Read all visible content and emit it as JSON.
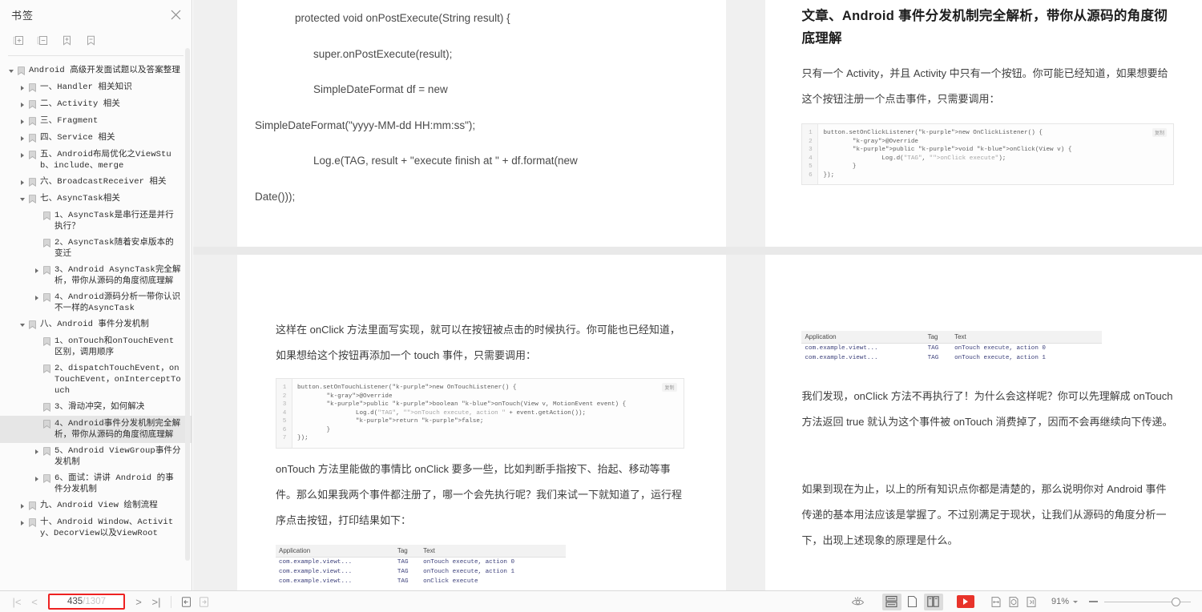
{
  "sidebar": {
    "panel_title": "书签",
    "close_label": "×",
    "toolbar": [
      {
        "name": "expand-all-icon",
        "title": "展开全部"
      },
      {
        "name": "collapse-all-icon",
        "title": "折叠全部"
      },
      {
        "name": "add-bookmark-icon",
        "title": "添加书签"
      },
      {
        "name": "remove-bookmark-icon",
        "title": "删除书签"
      }
    ],
    "tree": [
      {
        "level": 0,
        "state": "expanded",
        "label": "Android 高级开发面试题以及答案整理",
        "selected": false
      },
      {
        "level": 1,
        "state": "collapsed",
        "label": "一、Handler 相关知识",
        "selected": false
      },
      {
        "level": 1,
        "state": "collapsed",
        "label": "二、Activity 相关",
        "selected": false
      },
      {
        "level": 1,
        "state": "collapsed",
        "label": "三、Fragment",
        "selected": false
      },
      {
        "level": 1,
        "state": "collapsed",
        "label": "四、Service 相关",
        "selected": false
      },
      {
        "level": 1,
        "state": "collapsed",
        "label": "五、Android布局优化之ViewStub、include、merge",
        "selected": false
      },
      {
        "level": 1,
        "state": "collapsed",
        "label": "六、BroadcastReceiver 相关",
        "selected": false
      },
      {
        "level": 1,
        "state": "expanded",
        "label": "七、AsyncTask相关",
        "selected": false
      },
      {
        "level": 2,
        "state": "leaf",
        "label": "1、AsyncTask是串行还是并行执行？",
        "selected": false
      },
      {
        "level": 2,
        "state": "leaf",
        "label": "2、AsyncTask随着安卓版本的变迁",
        "selected": false
      },
      {
        "level": 2,
        "state": "collapsed",
        "label": "3、Android AsyncTask完全解析，带你从源码的角度彻底理解",
        "selected": false
      },
      {
        "level": 2,
        "state": "collapsed",
        "label": "4、Android源码分析一带你认识不一样的AsyncTask",
        "selected": false
      },
      {
        "level": 1,
        "state": "expanded",
        "label": "八、Android 事件分发机制",
        "selected": false
      },
      {
        "level": 2,
        "state": "leaf",
        "label": "1、onTouch和onTouchEvent区别，调用顺序",
        "selected": false
      },
      {
        "level": 2,
        "state": "leaf",
        "label": "2、dispatchTouchEvent，onTouchEvent，onInterceptTouch",
        "selected": false
      },
      {
        "level": 2,
        "state": "leaf",
        "label": "3、滑动冲突，如何解决",
        "selected": false
      },
      {
        "level": 2,
        "state": "leaf",
        "label": "4、Android事件分发机制完全解析，带你从源码的角度彻底理解",
        "selected": true
      },
      {
        "level": 2,
        "state": "collapsed",
        "label": "5、Android ViewGroup事件分发机制",
        "selected": false
      },
      {
        "level": 2,
        "state": "collapsed",
        "label": "6、面试：讲讲 Android 的事件分发机制",
        "selected": false
      },
      {
        "level": 1,
        "state": "collapsed",
        "label": "九、Android View 绘制流程",
        "selected": false
      },
      {
        "level": 1,
        "state": "collapsed",
        "label": "十、Android Window、Activity、DecorView以及ViewRoot",
        "selected": false
      }
    ]
  },
  "document": {
    "page_top_left": {
      "code_lines": [
        {
          "text": "protected void onPostExecute(String result) {",
          "indent": 50
        },
        {
          "text": "super.onPostExecute(result);",
          "indent": 73
        },
        {
          "text": "SimpleDateFormat df = new",
          "indent": 73
        },
        {
          "text": "SimpleDateFormat(\"yyyy-MM-dd HH:mm:ss\");",
          "indent": 0
        },
        {
          "text": "Log.e(TAG, result + \"execute finish at \" + df.format(new",
          "indent": 73
        },
        {
          "text": "Date()));",
          "indent": 0
        }
      ]
    },
    "page_top_right": {
      "heading": "文章、Android 事件分发机制完全解析，带你从源码的角度彻底理解",
      "paragraph": "只有一个 Activity，并且 Activity 中只有一个按钮。你可能已经知道，如果想要给这个按钮注册一个点击事件，只需要调用：",
      "code_block": {
        "copy_label": "复制",
        "lines": [
          {
            "no": "1",
            "text": "button.setOnClickListener(new OnClickListener() {"
          },
          {
            "no": "2",
            "text": "        @Override"
          },
          {
            "no": "3",
            "text": "        public void onClick(View v) {"
          },
          {
            "no": "4",
            "text": "                Log.d(\"TAG\", \"onClick execute\");"
          },
          {
            "no": "5",
            "text": "        }"
          },
          {
            "no": "6",
            "text": "});"
          }
        ]
      }
    },
    "page_bottom_left": {
      "paragraph1": "这样在 onClick 方法里面写实现，就可以在按钮被点击的时候执行。你可能也已经知道，如果想给这个按钮再添加一个 touch 事件，只需要调用：",
      "code_block": {
        "copy_label": "复制",
        "lines": [
          {
            "no": "1",
            "text": "button.setOnTouchListener(new OnTouchListener() {"
          },
          {
            "no": "2",
            "text": "        @Override"
          },
          {
            "no": "3",
            "text": "        public boolean onTouch(View v, MotionEvent event) {"
          },
          {
            "no": "4",
            "text": "                Log.d(\"TAG\", \"onTouch execute, action \" + event.getAction());"
          },
          {
            "no": "5",
            "text": "                return false;"
          },
          {
            "no": "6",
            "text": "        }"
          },
          {
            "no": "7",
            "text": "});"
          }
        ]
      },
      "paragraph2": "onTouch 方法里能做的事情比 onClick 要多一些，比如判断手指按下、抬起、移动等事件。那么如果我两个事件都注册了，哪一个会先执行呢？我们来试一下就知道了，运行程序点击按钮，打印结果如下：",
      "log_table": {
        "headers": [
          "Application",
          "Tag",
          "Text"
        ],
        "rows": [
          [
            "com.example.viewt...",
            "TAG",
            "onTouch execute, action 0"
          ],
          [
            "com.example.viewt...",
            "TAG",
            "onTouch execute, action 1"
          ],
          [
            "com.example.viewt...",
            "TAG",
            "onClick execute"
          ]
        ]
      }
    },
    "page_bottom_right": {
      "log_table": {
        "headers": [
          "Application",
          "Tag",
          "Text"
        ],
        "rows": [
          [
            "com.example.viewt...",
            "TAG",
            "onTouch execute, action 0"
          ],
          [
            "com.example.viewt...",
            "TAG",
            "onTouch execute, action 1"
          ]
        ]
      },
      "paragraph1": "我们发现，onClick 方法不再执行了！为什么会这样呢？你可以先理解成 onTouch 方法返回 true 就认为这个事件被 onTouch 消费掉了，因而不会再继续向下传递。",
      "paragraph2": "如果到现在为止，以上的所有知识点你都是清楚的，那么说明你对 Android 事件传递的基本用法应该是掌握了。不过别满足于现状，让我们从源码的角度分析一下，出现上述现象的原理是什么。"
    }
  },
  "bottombar": {
    "first_page_label": "|<",
    "prev_page_label": "<",
    "current_page": "435",
    "total_pages": "/1307",
    "next_page_label": ">",
    "last_page_label": ">|",
    "nav_icons": [
      {
        "name": "previous-view-icon"
      },
      {
        "name": "next-view-icon"
      }
    ],
    "view_modes": [
      {
        "name": "continuous-scroll-icon",
        "active": true
      },
      {
        "name": "single-page-icon",
        "active": false
      },
      {
        "name": "two-page-spread-icon",
        "active": false
      }
    ],
    "presentation_label": "演示",
    "fit_icons": [
      {
        "name": "fit-width-icon"
      },
      {
        "name": "fit-page-icon"
      },
      {
        "name": "actual-size-icon"
      }
    ],
    "eye_icon": "reading-mode-icon",
    "zoom_level": "91%",
    "accent_red": "#ee2222",
    "highlight_gray": "#e6e6e6"
  }
}
